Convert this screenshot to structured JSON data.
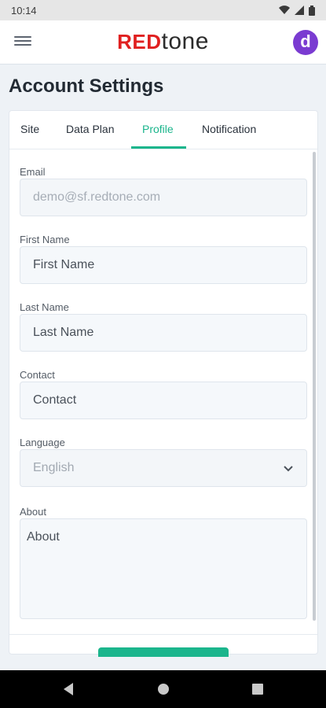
{
  "status_bar": {
    "time": "10:14"
  },
  "app_bar": {
    "logo_red": "RED",
    "logo_rest": "tone",
    "avatar_letter": "d"
  },
  "page": {
    "title": "Account Settings"
  },
  "tabs": [
    {
      "label": "Site",
      "active": false
    },
    {
      "label": "Data Plan",
      "active": false
    },
    {
      "label": "Profile",
      "active": true
    },
    {
      "label": "Notification",
      "active": false
    }
  ],
  "form": {
    "email": {
      "label": "Email",
      "value": "demo@sf.redtone.com"
    },
    "first_name": {
      "label": "First Name",
      "placeholder": "First Name"
    },
    "last_name": {
      "label": "Last Name",
      "placeholder": "Last Name"
    },
    "contact": {
      "label": "Contact",
      "placeholder": "Contact"
    },
    "language": {
      "label": "Language",
      "selected": "English"
    },
    "about": {
      "label": "About",
      "placeholder": "About"
    }
  },
  "colors": {
    "accent": "#1bb58c",
    "brand_red": "#e02020",
    "avatar": "#7a3bd1"
  },
  "icons": {
    "menu": "hamburger-menu-icon",
    "wifi": "wifi-icon",
    "signal": "signal-icon",
    "battery": "battery-icon",
    "dropdown": "chevron-down-icon",
    "back": "back-triangle-icon",
    "home": "home-circle-icon",
    "recents": "recents-square-icon"
  }
}
